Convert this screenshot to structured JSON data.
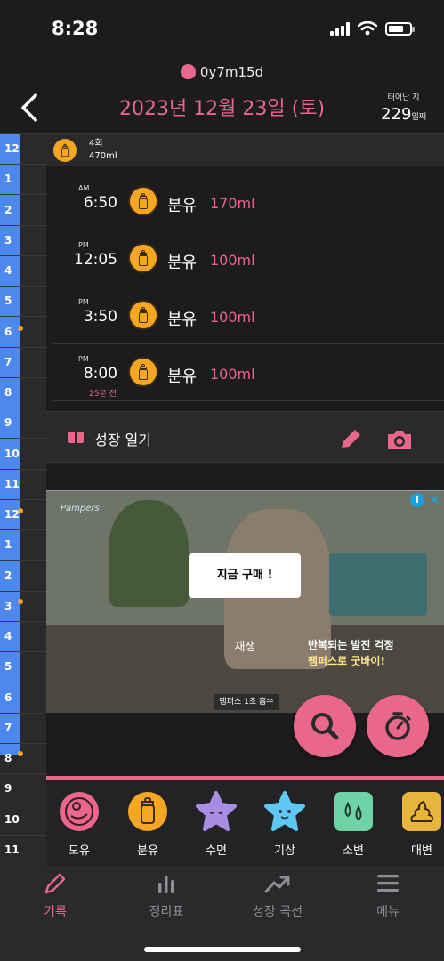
{
  "status": {
    "time": "8:28"
  },
  "header": {
    "baby_name": "0y7m15d",
    "date": "2023년 12월 23일 (토)",
    "born_label": "태어난 지",
    "born_days": "229",
    "born_unit": "일째"
  },
  "timeline": {
    "hours": [
      "12",
      "1",
      "2",
      "3",
      "4",
      "5",
      "6",
      "7",
      "8",
      "9",
      "10",
      "11",
      "12",
      "1",
      "2",
      "3",
      "4",
      "5",
      "6",
      "7",
      "8",
      "9",
      "10",
      "11"
    ]
  },
  "summary": {
    "count": "4회",
    "total": "470ml"
  },
  "records": [
    {
      "ampm": "AM",
      "time": "6:50",
      "type": "분유",
      "amount": "170ml",
      "ago": ""
    },
    {
      "ampm": "PM",
      "time": "12:05",
      "type": "분유",
      "amount": "100ml",
      "ago": ""
    },
    {
      "ampm": "PM",
      "time": "3:50",
      "type": "분유",
      "amount": "100ml",
      "ago": ""
    },
    {
      "ampm": "PM",
      "time": "8:00",
      "type": "분유",
      "amount": "100ml",
      "ago": "25분 전"
    }
  ],
  "diary": {
    "label": "성장 일기"
  },
  "ad": {
    "brand": "Pampers",
    "buy_label": "지금 구매 !",
    "play_label": "재생",
    "copy_line1": "반복되는 발진 걱정",
    "copy_line2": "팸퍼스로 굿바이!",
    "caption": "팸퍼스 1초 흡수",
    "info": "i",
    "close": "✕"
  },
  "quick_add": [
    {
      "label": "모유",
      "color": "#e8678b",
      "icon": "mother-icon"
    },
    {
      "label": "분유",
      "color": "#f5a623",
      "icon": "bottle-icon"
    },
    {
      "label": "수면",
      "color": "#a98de3",
      "icon": "sleep-star-icon"
    },
    {
      "label": "기상",
      "color": "#5ec8f2",
      "icon": "wake-star-icon"
    },
    {
      "label": "소변",
      "color": "#6fd3a6",
      "icon": "pee-icon"
    },
    {
      "label": "대변",
      "color": "#e8b53c",
      "icon": "poop-icon"
    }
  ],
  "tabs": [
    {
      "label": "기록",
      "icon": "pencil-icon",
      "active": true
    },
    {
      "label": "정리표",
      "icon": "bar-chart-icon",
      "active": false
    },
    {
      "label": "성장 곡선",
      "icon": "trend-icon",
      "active": false
    },
    {
      "label": "메뉴",
      "icon": "hamburger-icon",
      "active": false
    }
  ]
}
